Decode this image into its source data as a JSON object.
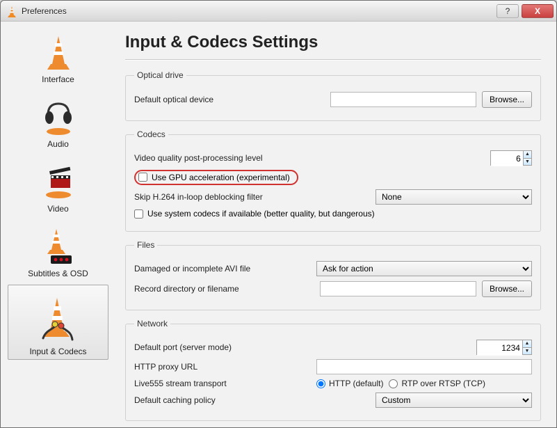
{
  "window": {
    "title": "Preferences"
  },
  "titlebar": {
    "help": "?",
    "close": "X"
  },
  "sidebar": {
    "items": [
      {
        "label": "Interface"
      },
      {
        "label": "Audio"
      },
      {
        "label": "Video"
      },
      {
        "label": "Subtitles & OSD"
      },
      {
        "label": "Input & Codecs"
      }
    ]
  },
  "page": {
    "title": "Input & Codecs Settings",
    "optical": {
      "legend": "Optical drive",
      "default_device_label": "Default optical device",
      "default_device_value": "",
      "browse": "Browse..."
    },
    "codecs": {
      "legend": "Codecs",
      "vqpp_label": "Video quality post-processing level",
      "vqpp_value": "6",
      "gpu_label": "Use GPU acceleration (experimental)",
      "skip_label": "Skip H.264 in-loop deblocking filter",
      "skip_value": "None",
      "syscodecs_label": "Use system codecs if available (better quality, but dangerous)"
    },
    "files": {
      "legend": "Files",
      "avi_label": "Damaged or incomplete AVI file",
      "avi_value": "Ask for action",
      "record_label": "Record directory or filename",
      "record_value": "",
      "browse": "Browse..."
    },
    "network": {
      "legend": "Network",
      "port_label": "Default port (server mode)",
      "port_value": "1234",
      "proxy_label": "HTTP proxy URL",
      "proxy_value": "",
      "transport_label": "Live555 stream transport",
      "transport_http": "HTTP (default)",
      "transport_rtp": "RTP over RTSP (TCP)",
      "caching_label": "Default caching policy",
      "caching_value": "Custom"
    }
  }
}
